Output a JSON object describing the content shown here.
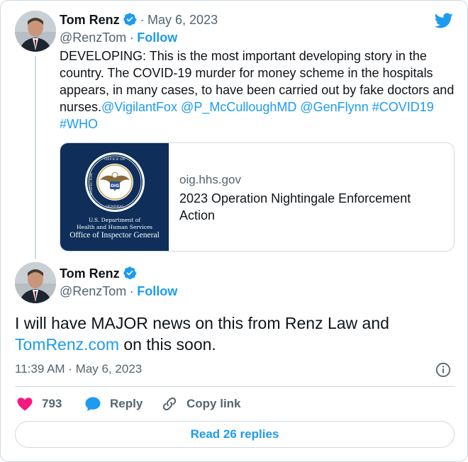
{
  "colors": {
    "accent": "#1d9bf0",
    "text": "#0f1419",
    "secondary": "#536471",
    "border": "#cfd9de",
    "like": "#f91880",
    "seal_bg": "#0f2f5a"
  },
  "quoted_tweet": {
    "author_name": "Tom Renz",
    "author_handle": "@RenzTom",
    "separator": "·",
    "date": "May 6, 2023",
    "follow_label": "Follow",
    "text_main": "DEVELOPING: This is the most important developing story in the country. The COVID-19 murder for money scheme in the hospitals appears, in many cases, to have been carried out by fake doctors and nurses.",
    "mentions": [
      "@VigilantFox",
      "@P_McCulloughMD",
      "@GenFlynn",
      "#COVID19",
      "#WHO"
    ],
    "link_card": {
      "domain": "oig.hhs.gov",
      "title": "2023 Operation Nightingale Enforcement Action",
      "image": {
        "caption_line1": "U.S. Department of",
        "caption_line2": "Health and Human Services",
        "caption_line3": "Office of Inspector General",
        "seal_center": "OIG"
      }
    }
  },
  "main_tweet": {
    "author_name": "Tom Renz",
    "author_handle": "@RenzTom",
    "follow_label": "Follow",
    "text_before_link": "I will have MAJOR news on this from Renz Law and ",
    "text_link": "TomRenz.com",
    "text_after_link": " on this soon.",
    "timestamp": "11:39 AM · May 6, 2023"
  },
  "actions": {
    "like_count": "793",
    "reply_label": "Reply",
    "copy_link_label": "Copy link"
  },
  "read_replies_label": "Read 26 replies",
  "icons": {
    "logo": "twitter-bird-icon",
    "verified": "verified-badge-icon",
    "info": "info-icon",
    "like": "heart-icon",
    "reply": "speech-bubble-icon",
    "copy_link": "link-icon"
  }
}
